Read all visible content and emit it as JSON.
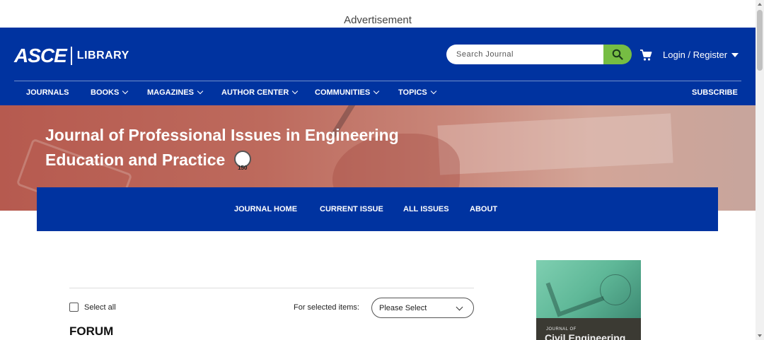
{
  "advertisement": {
    "label": "Advertisement"
  },
  "header": {
    "logo": {
      "brand": "ASCE",
      "library": "LIBRARY"
    },
    "search": {
      "placeholder": "Search Journal",
      "value": "",
      "icon": "search-icon"
    },
    "cart_icon": "cart-icon",
    "login_label": "Login / Register",
    "colors": {
      "bar": "#0033a0",
      "search_button": "#76bd43"
    }
  },
  "main_nav": {
    "items": [
      {
        "label": "JOURNALS",
        "dropdown": false
      },
      {
        "label": "BOOKS",
        "dropdown": true
      },
      {
        "label": "MAGAZINES",
        "dropdown": true
      },
      {
        "label": "AUTHOR CENTER",
        "dropdown": true
      },
      {
        "label": "COMMUNITIES",
        "dropdown": true
      },
      {
        "label": "TOPICS",
        "dropdown": true
      }
    ],
    "subscribe_label": "SUBSCRIBE"
  },
  "hero": {
    "title_line1": "Journal of Professional Issues in Engineering",
    "title_line2": "Education and Practice",
    "badge_text": "150"
  },
  "journal_nav": {
    "items": [
      {
        "label": "JOURNAL HOME"
      },
      {
        "label": "CURRENT ISSUE"
      },
      {
        "label": "ALL ISSUES"
      },
      {
        "label": "ABOUT"
      }
    ]
  },
  "results": {
    "select_all_label": "Select all",
    "select_all_checked": false,
    "for_selected_label": "For selected items:",
    "action_select": {
      "selected": "Please Select"
    },
    "section_heading": "FORUM"
  },
  "sidebar": {
    "cover": {
      "small_text": "JOURNAL OF",
      "title_text": "Civil Engineering"
    }
  }
}
